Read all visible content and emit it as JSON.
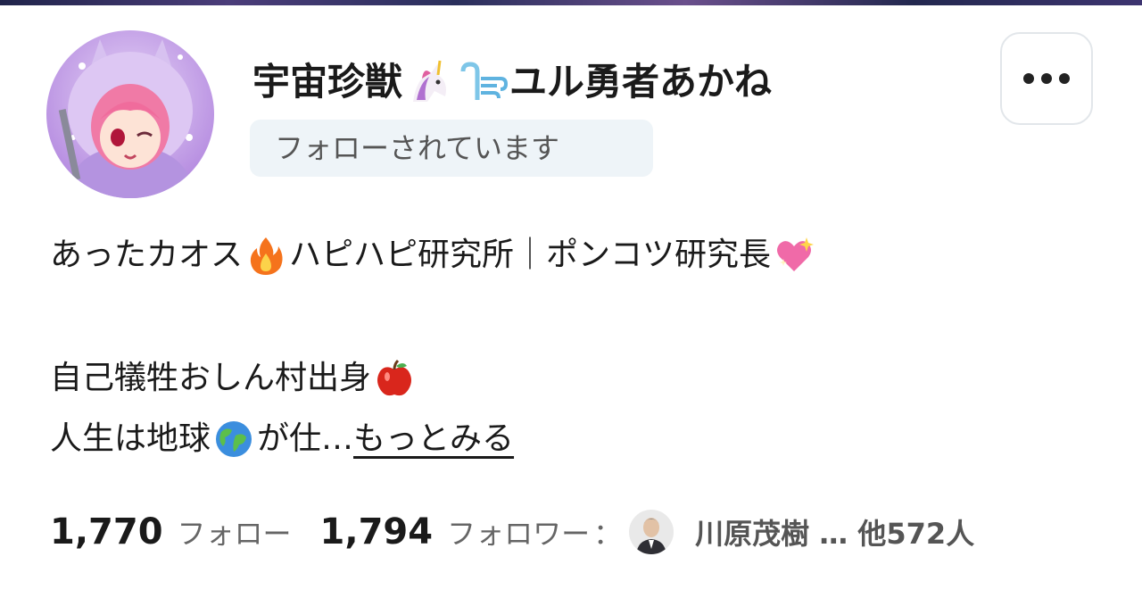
{
  "profile": {
    "name_part1": "宇宙珍獣",
    "name_part2": "ユル勇者あかね",
    "name_emoji": [
      "unicorn-emoji",
      "wind-emoji"
    ],
    "follows_you": "フォローされています"
  },
  "bio": {
    "line1_a": "あったカオス",
    "line1_b": "ハピハピ研究所｜ポンコツ研究長",
    "line2": "自己犠牲おしん村出身",
    "line3_a": "人生は地球",
    "line3_b": "が仕…",
    "see_more": "もっとみる",
    "emoji": [
      "fire-emoji",
      "sparkling-heart-emoji",
      "apple-emoji",
      "globe-emoji"
    ]
  },
  "stats": {
    "following_count": "1,770",
    "following_label": "フォロー",
    "followers_count": "1,794",
    "followers_label": "フォロワー",
    "colon": "：",
    "mutual_text": "川原茂樹 … 他572人"
  },
  "menu": {
    "icon": "more-dots-icon"
  },
  "colors": {
    "badge_bg": "#eef4f8",
    "text": "#1a1a1a",
    "muted": "#666666",
    "avatar_bg": "#c9a6ea"
  }
}
